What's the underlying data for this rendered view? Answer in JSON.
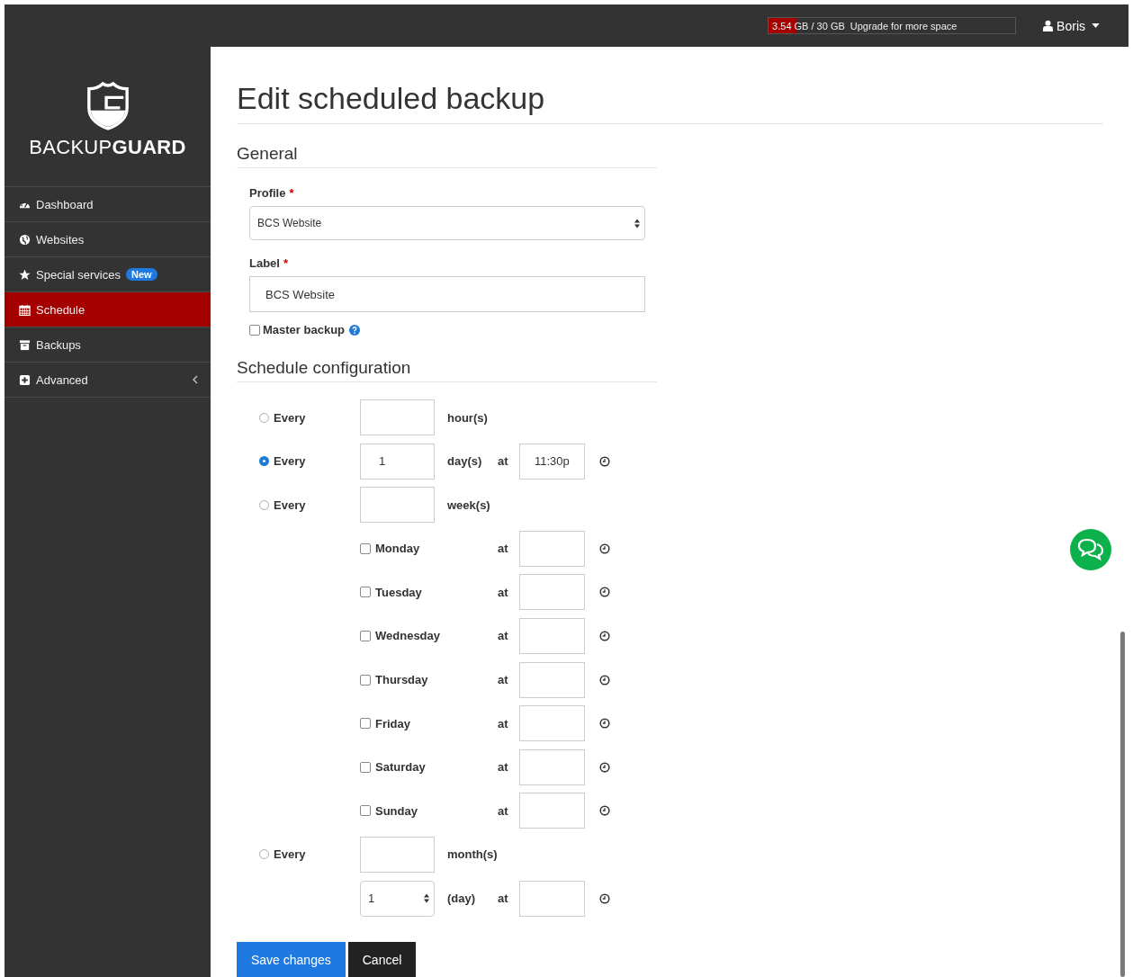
{
  "topbar": {
    "storage": {
      "used": "3.54 GB / 30 GB",
      "level": 0.118,
      "link": "Upgrade for more space"
    },
    "user": {
      "name": "Boris"
    }
  },
  "sidebar": {
    "logo": "BACKUP**GUARD**",
    "items": [
      {
        "kind": "dashboard",
        "label": "Dashboard",
        "selected": false
      },
      {
        "kind": "websites",
        "label": "Websites",
        "selected": false
      },
      {
        "kind": "special",
        "label": "Special services",
        "badge": "New",
        "selected": false
      },
      {
        "kind": "schedule",
        "label": "Schedule",
        "selected": true
      },
      {
        "kind": "backups",
        "label": "Backups",
        "selected": false
      },
      {
        "kind": "advanced",
        "label": "Advanced",
        "selected": false,
        "expandable": true
      }
    ]
  },
  "page": {
    "title": "Edit scheduled backup",
    "general": {
      "heading": "General",
      "profile": {
        "label": "Profile",
        "required_mark": "*",
        "value": "BCS Website"
      },
      "label_field": {
        "label": "Label",
        "required_mark": "*",
        "value": "BCS Website"
      },
      "master_backup": {
        "label": "Master backup",
        "checked": false
      }
    },
    "schedule": {
      "heading": "Schedule configuration",
      "options": [
        {
          "kind": "interval",
          "label": "Every",
          "selected": false,
          "unit": "hour(s)"
        },
        {
          "kind": "interval_time",
          "label": "Every",
          "selected": true,
          "value": "1",
          "unit": "day(s)",
          "at": "at",
          "time": "11:30p"
        },
        {
          "kind": "weekly",
          "label": "Every",
          "selected": false,
          "unit": "week(s)",
          "days": [
            {
              "day": "Monday",
              "checked": false,
              "at": "at"
            },
            {
              "day": "Tuesday",
              "checked": false,
              "at": "at"
            },
            {
              "day": "Wednesday",
              "checked": false,
              "at": "at"
            },
            {
              "day": "Thursday",
              "checked": false,
              "at": "at"
            },
            {
              "day": "Friday",
              "checked": false,
              "at": "at"
            },
            {
              "day": "Saturday",
              "checked": false,
              "at": "at"
            },
            {
              "day": "Sunday",
              "checked": false,
              "at": "at"
            }
          ]
        },
        {
          "kind": "monthly",
          "label": "Every",
          "selected": false,
          "unit": "month(s)",
          "day_select": "1",
          "day_unit": "(day)",
          "at": "at"
        }
      ]
    },
    "buttons": [
      {
        "kind": "primary",
        "label": "Save changes"
      },
      {
        "kind": "secondary",
        "label": "Cancel"
      }
    ]
  }
}
